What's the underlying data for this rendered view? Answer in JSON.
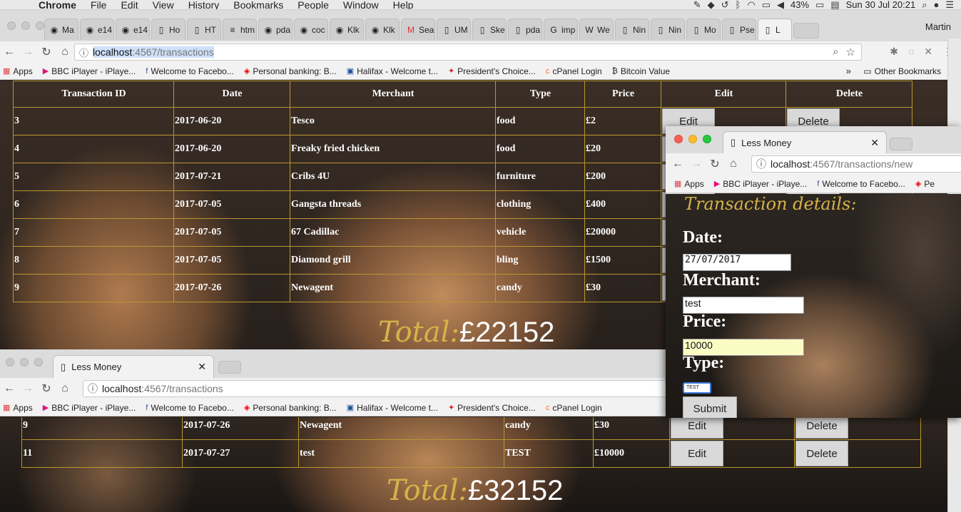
{
  "menubar": {
    "app": "Chrome",
    "items": [
      "File",
      "Edit",
      "View",
      "History",
      "Bookmarks",
      "People",
      "Window",
      "Help"
    ],
    "battery": "43%",
    "clock": "Sun 30 Jul  20:21"
  },
  "main_window": {
    "tabs": [
      {
        "icon": "github-icon",
        "label": "Ma"
      },
      {
        "icon": "github-icon",
        "label": "e14"
      },
      {
        "icon": "github-icon",
        "label": "e14"
      },
      {
        "icon": "page-icon",
        "label": "Ho"
      },
      {
        "icon": "page-icon",
        "label": "HT"
      },
      {
        "icon": "stackoverflow-icon",
        "label": "htm"
      },
      {
        "icon": "github-icon",
        "label": "pda"
      },
      {
        "icon": "github-icon",
        "label": "coc"
      },
      {
        "icon": "github-icon",
        "label": "Klk"
      },
      {
        "icon": "github-icon",
        "label": "Klk"
      },
      {
        "icon": "gmail-icon",
        "label": "Sea"
      },
      {
        "icon": "page-icon",
        "label": "UM"
      },
      {
        "icon": "page-icon",
        "label": "Ske"
      },
      {
        "icon": "page-icon",
        "label": "pda"
      },
      {
        "icon": "google-icon",
        "label": "imp"
      },
      {
        "icon": "wikipedia-icon",
        "label": "We"
      },
      {
        "icon": "page-icon",
        "label": "Nin"
      },
      {
        "icon": "page-icon",
        "label": "Nin"
      },
      {
        "icon": "page-icon",
        "label": "Mo"
      },
      {
        "icon": "page-icon",
        "label": "Pse"
      },
      {
        "icon": "page-icon",
        "label": "L"
      }
    ],
    "profile": "Martin",
    "url_host": "localhost",
    "url_path": ":4567/transactions",
    "bookmarks": [
      {
        "icon": "apps-icon",
        "label": "Apps"
      },
      {
        "icon": "iplayer-icon",
        "label": "BBC iPlayer - iPlaye..."
      },
      {
        "icon": "facebook-icon",
        "label": "Welcome to Facebo..."
      },
      {
        "icon": "santander-icon",
        "label": "Personal banking: B..."
      },
      {
        "icon": "halifax-icon",
        "label": "Halifax - Welcome t..."
      },
      {
        "icon": "maple-leaf-icon",
        "label": "President's Choice..."
      },
      {
        "icon": "cpanel-icon",
        "label": "cPanel Login"
      },
      {
        "icon": "bitcoin-icon",
        "label": "Bitcoin Value"
      }
    ],
    "other_bookmarks": "Other Bookmarks",
    "table": {
      "headers": [
        "Transaction ID",
        "Date",
        "Merchant",
        "Type",
        "Price",
        "Edit",
        "Delete"
      ],
      "rows": [
        {
          "id": "3",
          "date": "2017-06-20",
          "merchant": "Tesco",
          "type": "food",
          "price": "£2"
        },
        {
          "id": "4",
          "date": "2017-06-20",
          "merchant": "Freaky fried chicken",
          "type": "food",
          "price": "£20"
        },
        {
          "id": "5",
          "date": "2017-07-21",
          "merchant": "Cribs 4U",
          "type": "furniture",
          "price": "£200"
        },
        {
          "id": "6",
          "date": "2017-07-05",
          "merchant": "Gangsta threads",
          "type": "clothing",
          "price": "£400"
        },
        {
          "id": "7",
          "date": "2017-07-05",
          "merchant": "67 Cadillac",
          "type": "vehicle",
          "price": "£20000"
        },
        {
          "id": "8",
          "date": "2017-07-05",
          "merchant": "Diamond grill",
          "type": "bling",
          "price": "£1500"
        },
        {
          "id": "9",
          "date": "2017-07-26",
          "merchant": "Newagent",
          "type": "candy",
          "price": "£30"
        }
      ],
      "edit_label": "Edit",
      "delete_label": "Delete"
    },
    "total_label": "Total:",
    "total_value": "£22152"
  },
  "bottom_window": {
    "tab_title": "Less Money",
    "url_host": "localhost",
    "url_path": ":4567/transactions",
    "bookmarks": [
      {
        "icon": "apps-icon",
        "label": "Apps"
      },
      {
        "icon": "iplayer-icon",
        "label": "BBC iPlayer - iPlaye..."
      },
      {
        "icon": "facebook-icon",
        "label": "Welcome to Facebo..."
      },
      {
        "icon": "santander-icon",
        "label": "Personal banking: B..."
      },
      {
        "icon": "halifax-icon",
        "label": "Halifax - Welcome t..."
      },
      {
        "icon": "maple-leaf-icon",
        "label": "President's Choice..."
      },
      {
        "icon": "cpanel-icon",
        "label": "cPanel Login"
      }
    ],
    "rows": [
      {
        "id": "9",
        "date": "2017-07-26",
        "merchant": "Newagent",
        "type": "candy",
        "price": "£30"
      },
      {
        "id": "11",
        "date": "2017-07-27",
        "merchant": "test",
        "type": "TEST",
        "price": "£10000"
      }
    ],
    "edit_label": "Edit",
    "delete_label": "Delete",
    "total_label": "Total:",
    "total_value": "£32152"
  },
  "popup_window": {
    "tab_title": "Less Money",
    "url_host": "localhost",
    "url_path": ":4567/transactions/new",
    "bookmarks": [
      {
        "icon": "apps-icon",
        "label": "Apps"
      },
      {
        "icon": "iplayer-icon",
        "label": "BBC iPlayer - iPlaye..."
      },
      {
        "icon": "facebook-icon",
        "label": "Welcome to Facebo..."
      },
      {
        "icon": "santander-icon",
        "label": "Pe"
      }
    ],
    "form": {
      "title": "Transaction details:",
      "date_label": "Date:",
      "date_value": "27/07/2017",
      "merchant_label": "Merchant:",
      "merchant_value": "test",
      "price_label": "Price:",
      "price_value": "10000",
      "type_label": "Type:",
      "type_value": "TEST",
      "submit_label": "Submit"
    }
  },
  "colors": {
    "gold": "#d6b24a",
    "table_border": "#b9962f"
  }
}
